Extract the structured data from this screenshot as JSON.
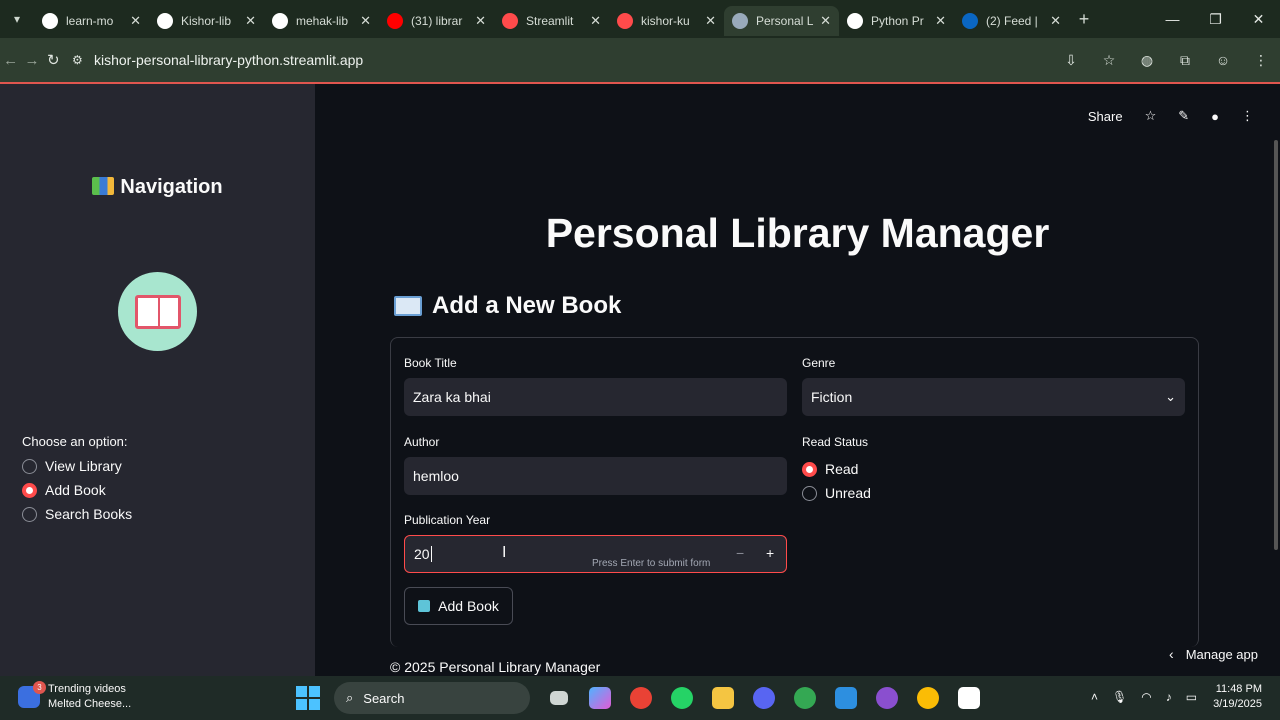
{
  "browser": {
    "tabs": [
      {
        "label": "learn-mo",
        "icon": "github-icon",
        "color": "#ffffff"
      },
      {
        "label": "Kishor-lib",
        "icon": "github-icon",
        "color": "#ffffff"
      },
      {
        "label": "mehak-lib",
        "icon": "github-icon",
        "color": "#ffffff"
      },
      {
        "label": "(31) librar",
        "icon": "youtube-icon",
        "color": "#ff0000"
      },
      {
        "label": "Streamlit",
        "icon": "streamlit-icon",
        "color": "#ff4b4b"
      },
      {
        "label": "kishor-ku",
        "icon": "streamlit-icon",
        "color": "#ff4b4b"
      },
      {
        "label": "Personal L",
        "icon": "page-icon",
        "color": "#9ab"
      },
      {
        "label": "Python Pr",
        "icon": "openai-icon",
        "color": "#ffffff"
      },
      {
        "label": "(2) Feed |",
        "icon": "linkedin-icon",
        "color": "#0a66c2"
      }
    ],
    "url": "kishor-personal-library-python.streamlit.app"
  },
  "toolbar": {
    "share_label": "Share"
  },
  "sidebar": {
    "title": "Navigation",
    "choose_label": "Choose an option:",
    "options": [
      {
        "label": "View Library",
        "selected": false
      },
      {
        "label": "Add Book",
        "selected": true
      },
      {
        "label": "Search Books",
        "selected": false
      }
    ]
  },
  "main": {
    "title": "Personal Library Manager",
    "section_title": "Add a New Book",
    "form": {
      "title_label": "Book Title",
      "title_value": "Zara ka bhai",
      "genre_label": "Genre",
      "genre_value": "Fiction",
      "author_label": "Author",
      "author_value": "hemloo",
      "status_label": "Read Status",
      "status_options": [
        {
          "label": "Read",
          "selected": true
        },
        {
          "label": "Unread",
          "selected": false
        }
      ],
      "year_label": "Publication Year",
      "year_value": "20",
      "year_hint": "Press Enter to submit form",
      "stepper_minus": "−",
      "stepper_plus": "+",
      "submit_label": "Add Book"
    },
    "footer": "© 2025 Personal Library Manager",
    "manage_label": "Manage app"
  },
  "taskbar": {
    "news_badge": "3",
    "news_line1": "Trending videos",
    "news_line2": "Melted Cheese...",
    "search_label": "Search",
    "time": "11:48 PM",
    "date": "3/19/2025"
  }
}
